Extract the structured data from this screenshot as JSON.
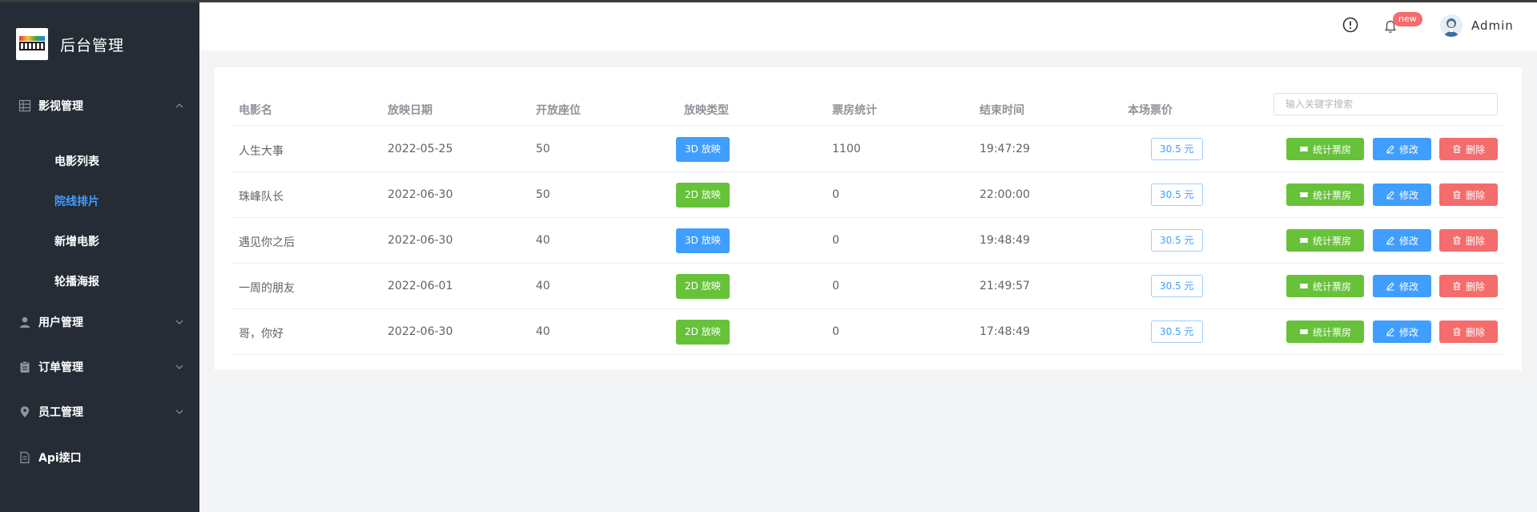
{
  "app": {
    "title": "后台管理"
  },
  "sidebar": {
    "groups": [
      {
        "label": "影视管理",
        "icon": "grid-icon",
        "expanded": true,
        "items": [
          {
            "label": "电影列表",
            "active": false
          },
          {
            "label": "院线排片",
            "active": true
          },
          {
            "label": "新增电影",
            "active": false
          },
          {
            "label": "轮播海报",
            "active": false
          }
        ]
      },
      {
        "label": "用户管理",
        "icon": "user-icon",
        "expanded": false
      },
      {
        "label": "订单管理",
        "icon": "clipboard-icon",
        "expanded": false
      },
      {
        "label": "员工管理",
        "icon": "location-icon",
        "expanded": false
      },
      {
        "label": "Api接口",
        "icon": "document-icon",
        "expanded": false
      }
    ]
  },
  "header": {
    "badge": "new",
    "user": "Admin",
    "icons": [
      "info-icon",
      "bell-icon",
      "avatar"
    ]
  },
  "table": {
    "columns": [
      "电影名",
      "放映日期",
      "开放座位",
      "放映类型",
      "票房统计",
      "结束时间",
      "本场票价"
    ],
    "search_placeholder": "输入关键字搜索",
    "actions": {
      "stat": "统计票房",
      "edit": "修改",
      "delete": "删除"
    },
    "rows": [
      {
        "name": "人生大事",
        "date": "2022-05-25",
        "seats": "50",
        "type": "3D 放映",
        "box": "1100",
        "end": "19:47:29",
        "price": "30.5 元"
      },
      {
        "name": "珠峰队长",
        "date": "2022-06-30",
        "seats": "50",
        "type": "2D 放映",
        "box": "0",
        "end": "22:00:00",
        "price": "30.5 元"
      },
      {
        "name": "遇见你之后",
        "date": "2022-06-30",
        "seats": "40",
        "type": "3D 放映",
        "box": "0",
        "end": "19:48:49",
        "price": "30.5 元"
      },
      {
        "name": "一周的朋友",
        "date": "2022-06-01",
        "seats": "40",
        "type": "2D 放映",
        "box": "0",
        "end": "21:49:57",
        "price": "30.5 元"
      },
      {
        "name": "哥，你好",
        "date": "2022-06-30",
        "seats": "40",
        "type": "2D 放映",
        "box": "0",
        "end": "17:48:49",
        "price": "30.5 元"
      }
    ]
  },
  "colors": {
    "sidebar": "#252c35",
    "primary": "#409eff",
    "success": "#67c23a",
    "danger": "#f56c6c"
  }
}
